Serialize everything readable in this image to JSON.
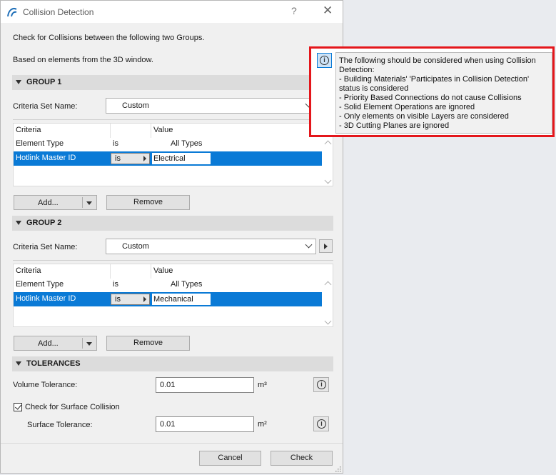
{
  "dialog": {
    "title": "Collision Detection",
    "help_glyph": "?",
    "close_glyph": "✕",
    "intro_line1": "Check for Collisions between the following two Groups.",
    "intro_line2": "Based on elements from the 3D window."
  },
  "group1": {
    "header": "GROUP 1",
    "criteria_label": "Criteria Set Name:",
    "criteria_value": "Custom",
    "table": {
      "headers": [
        "Criteria",
        "",
        "Value"
      ],
      "rows": [
        {
          "criteria": "Element Type",
          "operator": "is",
          "value": "All Types",
          "selected": false
        },
        {
          "criteria": "Hotlink Master ID",
          "operator": "is",
          "value": "Electrical",
          "selected": true
        }
      ]
    },
    "add_label": "Add...",
    "remove_label": "Remove"
  },
  "group2": {
    "header": "GROUP 2",
    "criteria_label": "Criteria Set Name:",
    "criteria_value": "Custom",
    "table": {
      "headers": [
        "Criteria",
        "",
        "Value"
      ],
      "rows": [
        {
          "criteria": "Element Type",
          "operator": "is",
          "value": "All Types",
          "selected": false
        },
        {
          "criteria": "Hotlink Master ID",
          "operator": "is",
          "value": "Mechanical",
          "selected": true
        }
      ]
    },
    "add_label": "Add...",
    "remove_label": "Remove"
  },
  "tolerances": {
    "header": "TOLERANCES",
    "volume_label": "Volume Tolerance:",
    "volume_value": "0.01",
    "volume_unit": "m³",
    "surface_check_label": "Check for Surface Collision",
    "surface_checked": true,
    "surface_label": "Surface Tolerance:",
    "surface_value": "0.01",
    "surface_unit": "m²"
  },
  "footer": {
    "cancel_label": "Cancel",
    "check_label": "Check"
  },
  "tooltip": {
    "lines": [
      "The following should be considered when using Collision",
      "Detection:",
      "- Building Materials' 'Participates in Collision Detection'",
      "status is considered",
      "- Priority Based Connections do not cause Collisions",
      "- Solid Element Operations are ignored",
      "- Only elements on visible Layers are considered",
      "- 3D Cutting Planes are ignored"
    ]
  },
  "icons": {
    "info_glyph": "i",
    "title_icon": "archicad-logo-icon"
  },
  "colors": {
    "accent": "#0a7ad6",
    "highlight_frame": "#e4161b",
    "section_bg": "#dcdcdc"
  }
}
